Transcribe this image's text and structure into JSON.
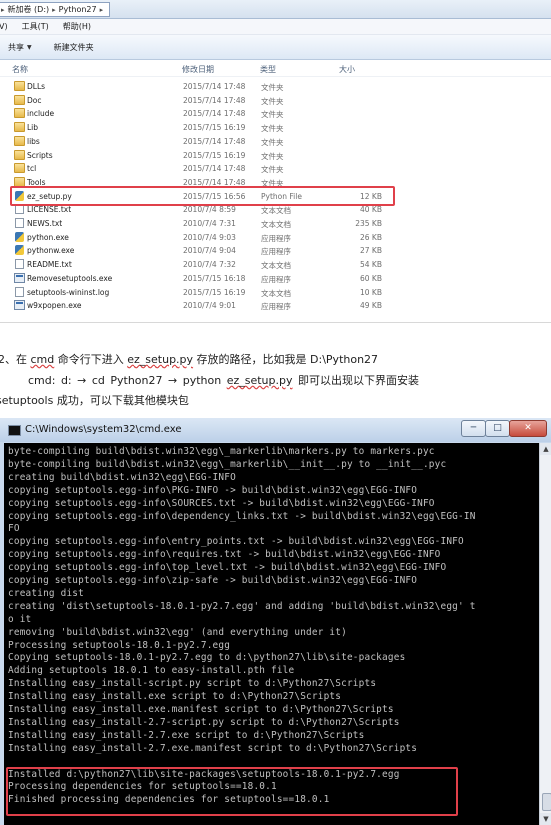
{
  "explorer": {
    "address": {
      "drive": "新加卷 (D:)",
      "folder": "Python27"
    },
    "menu": [
      "V)",
      "工具(T)",
      "帮助(H)"
    ],
    "toolbar": {
      "share": "共享",
      "new_folder": "新建文件夹"
    },
    "columns": {
      "name": "名称",
      "date": "修改日期",
      "type": "类型",
      "size": "大小"
    },
    "files": [
      {
        "name": "DLLs",
        "date": "2015/7/14 17:48",
        "type": "文件夹",
        "size": "",
        "icon": "folder-icon"
      },
      {
        "name": "Doc",
        "date": "2015/7/14 17:48",
        "type": "文件夹",
        "size": "",
        "icon": "folder-icon"
      },
      {
        "name": "include",
        "date": "2015/7/14 17:48",
        "type": "文件夹",
        "size": "",
        "icon": "folder-icon"
      },
      {
        "name": "Lib",
        "date": "2015/7/15 16:19",
        "type": "文件夹",
        "size": "",
        "icon": "folder-icon"
      },
      {
        "name": "libs",
        "date": "2015/7/14 17:48",
        "type": "文件夹",
        "size": "",
        "icon": "folder-icon"
      },
      {
        "name": "Scripts",
        "date": "2015/7/15 16:19",
        "type": "文件夹",
        "size": "",
        "icon": "folder-icon"
      },
      {
        "name": "tcl",
        "date": "2015/7/14 17:48",
        "type": "文件夹",
        "size": "",
        "icon": "folder-icon"
      },
      {
        "name": "Tools",
        "date": "2015/7/14 17:48",
        "type": "文件夹",
        "size": "",
        "icon": "folder-icon"
      },
      {
        "name": "ez_setup.py",
        "date": "2015/7/15 16:56",
        "type": "Python File",
        "size": "12 KB",
        "icon": "python-file-icon"
      },
      {
        "name": "LICENSE.txt",
        "date": "2010/7/4 8:59",
        "type": "文本文档",
        "size": "40 KB",
        "icon": "text-file-icon"
      },
      {
        "name": "NEWS.txt",
        "date": "2010/7/4 7:31",
        "type": "文本文档",
        "size": "235 KB",
        "icon": "text-file-icon"
      },
      {
        "name": "python.exe",
        "date": "2010/7/4 9:03",
        "type": "应用程序",
        "size": "26 KB",
        "icon": "python-exe-icon"
      },
      {
        "name": "pythonw.exe",
        "date": "2010/7/4 9:04",
        "type": "应用程序",
        "size": "27 KB",
        "icon": "python-exe-icon"
      },
      {
        "name": "README.txt",
        "date": "2010/7/4 7:32",
        "type": "文本文档",
        "size": "54 KB",
        "icon": "text-file-icon"
      },
      {
        "name": "Removesetuptools.exe",
        "date": "2015/7/15 16:18",
        "type": "应用程序",
        "size": "60 KB",
        "icon": "exe-icon"
      },
      {
        "name": "setuptools-wininst.log",
        "date": "2015/7/15 16:19",
        "type": "文本文档",
        "size": "10 KB",
        "icon": "text-file-icon"
      },
      {
        "name": "w9xpopen.exe",
        "date": "2010/7/4 9:01",
        "type": "应用程序",
        "size": "49 KB",
        "icon": "exe-icon"
      }
    ]
  },
  "article": {
    "line1_prefix": "2、在 ",
    "line1_cmd": "cmd",
    "line1_mid": " 命令行下进入 ",
    "line1_file": "ez_setup.py",
    "line1_suffix": " 存放的路径，比如我是 D:\\Python27",
    "line2_a": "cmd:    d:     →    cd Python27     → python ",
    "line2_file": "ez_setup.py",
    "line2_b": " 即可以出现以下界面安装",
    "line3": "setuptools 成功，可以下载其他模块包"
  },
  "cmd": {
    "title": "C:\\Windows\\system32\\cmd.exe",
    "buttons": {
      "minimize": "─",
      "maximize": "□",
      "close": "✕"
    },
    "lines": [
      "byte-compiling build\\bdist.win32\\egg\\_markerlib\\markers.py to markers.pyc",
      "byte-compiling build\\bdist.win32\\egg\\_markerlib\\__init__.py to __init__.pyc",
      "creating build\\bdist.win32\\egg\\EGG-INFO",
      "copying setuptools.egg-info\\PKG-INFO -> build\\bdist.win32\\egg\\EGG-INFO",
      "copying setuptools.egg-info\\SOURCES.txt -> build\\bdist.win32\\egg\\EGG-INFO",
      "copying setuptools.egg-info\\dependency_links.txt -> build\\bdist.win32\\egg\\EGG-IN",
      "FO",
      "copying setuptools.egg-info\\entry_points.txt -> build\\bdist.win32\\egg\\EGG-INFO",
      "copying setuptools.egg-info\\requires.txt -> build\\bdist.win32\\egg\\EGG-INFO",
      "copying setuptools.egg-info\\top_level.txt -> build\\bdist.win32\\egg\\EGG-INFO",
      "copying setuptools.egg-info\\zip-safe -> build\\bdist.win32\\egg\\EGG-INFO",
      "creating dist",
      "creating 'dist\\setuptools-18.0.1-py2.7.egg' and adding 'build\\bdist.win32\\egg' t",
      "o it",
      "removing 'build\\bdist.win32\\egg' (and everything under it)",
      "Processing setuptools-18.0.1-py2.7.egg",
      "Copying setuptools-18.0.1-py2.7.egg to d:\\python27\\lib\\site-packages",
      "Adding setuptools 18.0.1 to easy-install.pth file",
      "Installing easy_install-script.py script to d:\\Python27\\Scripts",
      "Installing easy_install.exe script to d:\\Python27\\Scripts",
      "Installing easy_install.exe.manifest script to d:\\Python27\\Scripts",
      "Installing easy_install-2.7-script.py script to d:\\Python27\\Scripts",
      "Installing easy_install-2.7.exe script to d:\\Python27\\Scripts",
      "Installing easy_install-2.7.exe.manifest script to d:\\Python27\\Scripts",
      "",
      "Installed d:\\python27\\lib\\site-packages\\setuptools-18.0.1-py2.7.egg",
      "Processing dependencies for setuptools==18.0.1",
      "Finished processing dependencies for setuptools==18.0.1"
    ]
  },
  "colors": {
    "highlight": "#e0404a",
    "console_bg": "#000000",
    "console_fg": "#c0c0c0"
  }
}
